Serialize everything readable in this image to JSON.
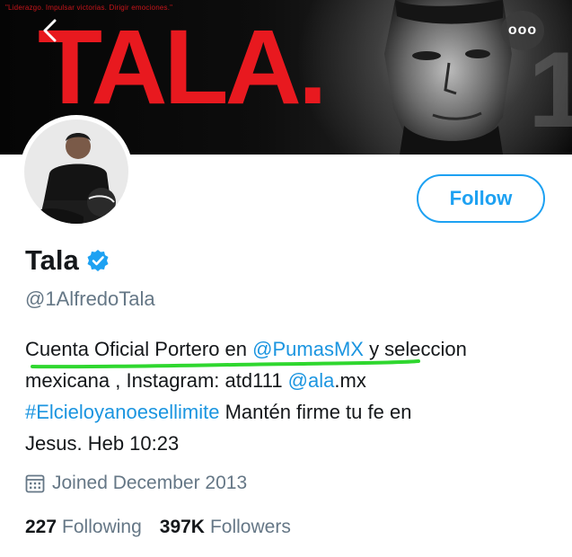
{
  "banner": {
    "tagline": "\"Liderazgo. Impulsar victorias. Dirigir emociones.\"",
    "brand_text": "TALA.",
    "numeral": "1"
  },
  "nav": {
    "back_icon": "chevron-left-icon",
    "more_icon": "more-horizontal-icon",
    "more_label": "ooo"
  },
  "profile": {
    "name": "Tala",
    "verified": true,
    "handle": "@1AlfredoTala",
    "follow_label": "Follow",
    "bio": {
      "line1_pre": "Cuenta Oficial Portero en ",
      "line1_mention": "@PumasMX",
      "line1_post": " y seleccion",
      "line2_pre": "mexicana , Instagram: atd111 ",
      "line2_mention": "@ala",
      "line2_post": ".mx",
      "line3_hashtag": "#Elcieloyanoesellimite",
      "line3_post": " Mantén firme tu fe en",
      "line4": "Jesus. Heb 10:23"
    },
    "joined": "Joined December 2013",
    "following_count": "227",
    "following_label": "Following",
    "followers_count": "397K",
    "followers_label": "Followers"
  },
  "colors": {
    "accent": "#1da1f2",
    "link": "#1b95e0",
    "brand_red": "#e8191f",
    "highlight_green": "#2fd72f",
    "muted": "#657786"
  }
}
